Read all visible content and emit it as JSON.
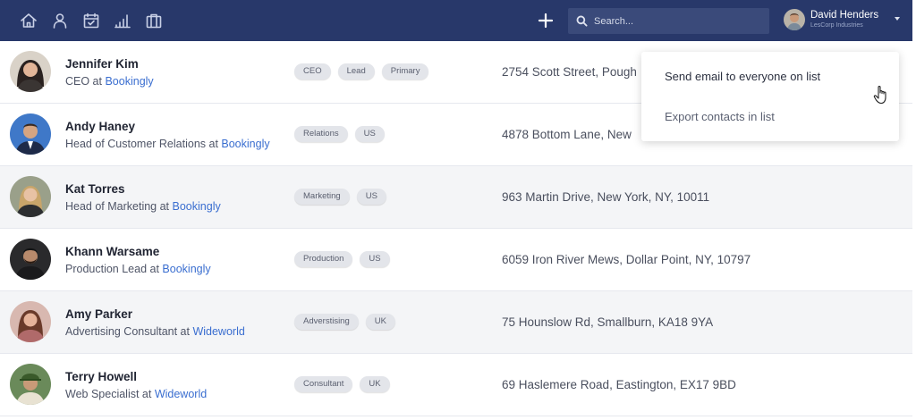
{
  "topbar": {
    "nav_icons": [
      "home-icon",
      "user-icon",
      "calendar-icon",
      "signal-bars-icon",
      "briefcase-icon"
    ],
    "search": {
      "placeholder": "Search..."
    },
    "user": {
      "name": "David Henders",
      "org": "LesCorp Industries"
    }
  },
  "contacts": [
    {
      "name": "Jennifer Kim",
      "title": "CEO at ",
      "company": "Bookingly",
      "tags": [
        "CEO",
        "Lead",
        "Primary"
      ],
      "address": "2754 Scott Street, Pough"
    },
    {
      "name": "Andy Haney",
      "title": "Head of Customer Relations at ",
      "company": "Bookingly",
      "tags": [
        "Relations",
        "US"
      ],
      "address": "4878 Bottom Lane, New"
    },
    {
      "name": "Kat Torres",
      "title": "Head of Marketing at ",
      "company": "Bookingly",
      "tags": [
        "Marketing",
        "US"
      ],
      "address": "963 Martin Drive, New York, NY, 10011"
    },
    {
      "name": "Khann Warsame",
      "title": "Production Lead at ",
      "company": "Bookingly",
      "tags": [
        "Production",
        "US"
      ],
      "address": "6059 Iron River Mews, Dollar Point, NY, 10797"
    },
    {
      "name": "Amy Parker",
      "title": "Advertising Consultant at ",
      "company": "Wideworld",
      "tags": [
        "Adverstising",
        "UK"
      ],
      "address": "75 Hounslow Rd, Smallburn, KA18 9YA"
    },
    {
      "name": "Terry Howell",
      "title": "Web Specialist at ",
      "company": "Wideworld",
      "tags": [
        "Consultant",
        "UK"
      ],
      "address": "69 Haslemere Road, Eastington, EX17 9BD"
    }
  ],
  "menu": {
    "send_email": "Send email to everyone on list",
    "export": "Export contacts in list"
  },
  "colors": {
    "topbar": "#28386a",
    "link": "#3a6ed0"
  }
}
